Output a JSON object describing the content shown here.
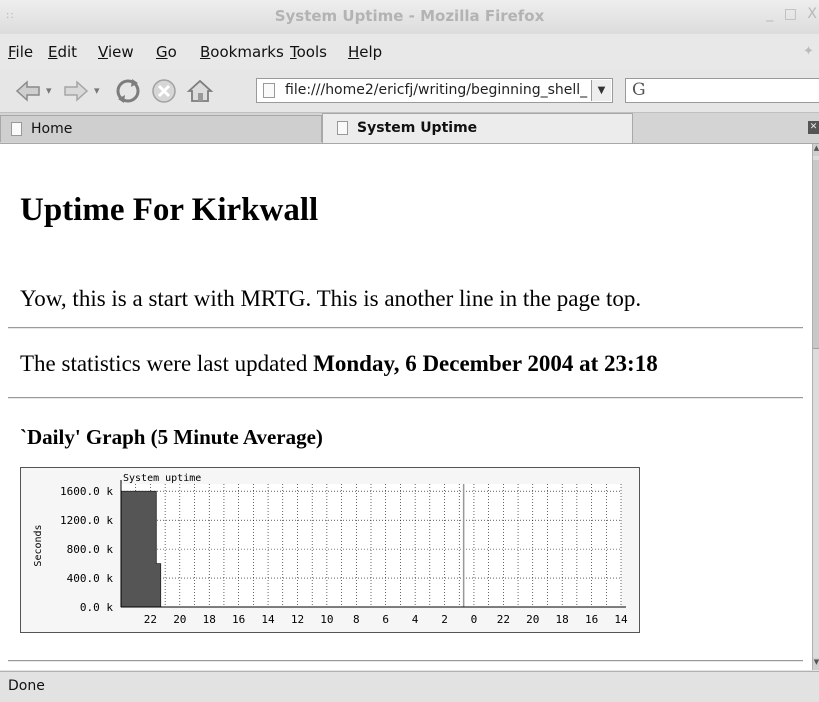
{
  "window": {
    "title": "System Uptime - Mozilla Firefox",
    "grip": "::",
    "controls": [
      "_",
      "□",
      "X"
    ]
  },
  "menu": {
    "items": [
      {
        "u": "F",
        "rest": "ile"
      },
      {
        "u": "E",
        "rest": "dit"
      },
      {
        "u": "V",
        "rest": "iew"
      },
      {
        "u": "G",
        "rest": "o"
      },
      {
        "u": "B",
        "rest": "ookmarks"
      },
      {
        "u": "T",
        "rest": "ools"
      },
      {
        "u": "H",
        "rest": "elp"
      }
    ]
  },
  "toolbar": {
    "url": "file:///home2/ericfj/writing/beginning_shell_",
    "search_engine_glyph": "G"
  },
  "tabs": [
    {
      "label": "Home",
      "active": false
    },
    {
      "label": "System Uptime",
      "active": true
    }
  ],
  "page": {
    "heading": "Uptime For Kirkwall",
    "intro": "Yow, this is a start with MRTG. This is another line in the page top.",
    "updated_prefix": "The statistics were last updated ",
    "updated_value": "Monday, 6 December 2004 at 23:18",
    "graph_heading": "`Daily' Graph (5 Minute Average)"
  },
  "status": {
    "text": "Done"
  },
  "colors": {
    "area_fill": "#555555",
    "grid": "#000000",
    "graph_bg": "#f6f6f6"
  },
  "chart_data": {
    "type": "area",
    "title": "System uptime",
    "ylabel": "Seconds",
    "xlabel": "",
    "x_tick_labels": [
      "22",
      "20",
      "18",
      "16",
      "14",
      "12",
      "10",
      "8",
      "6",
      "4",
      "2",
      "0",
      "22",
      "20",
      "18",
      "16",
      "14"
    ],
    "y_tick_labels": [
      "0.0 k",
      "400.0 k",
      "800.0 k",
      "1200.0 k",
      "1600.0 k"
    ],
    "y_ticks": [
      0,
      400,
      800,
      1200,
      1600
    ],
    "ylim": [
      0,
      1700
    ],
    "x_hours_ago_range": [
      0,
      34
    ],
    "day_boundary_hours_ago": 23.3,
    "series": [
      {
        "points": [
          {
            "hours_ago": 0.0,
            "value_k": 1600
          },
          {
            "hours_ago": 2.4,
            "value_k": 1600
          },
          {
            "hours_ago": 2.4,
            "value_k": 600
          },
          {
            "hours_ago": 2.7,
            "value_k": 600
          },
          {
            "hours_ago": 2.7,
            "value_k": 0
          }
        ]
      }
    ],
    "grid": true
  }
}
